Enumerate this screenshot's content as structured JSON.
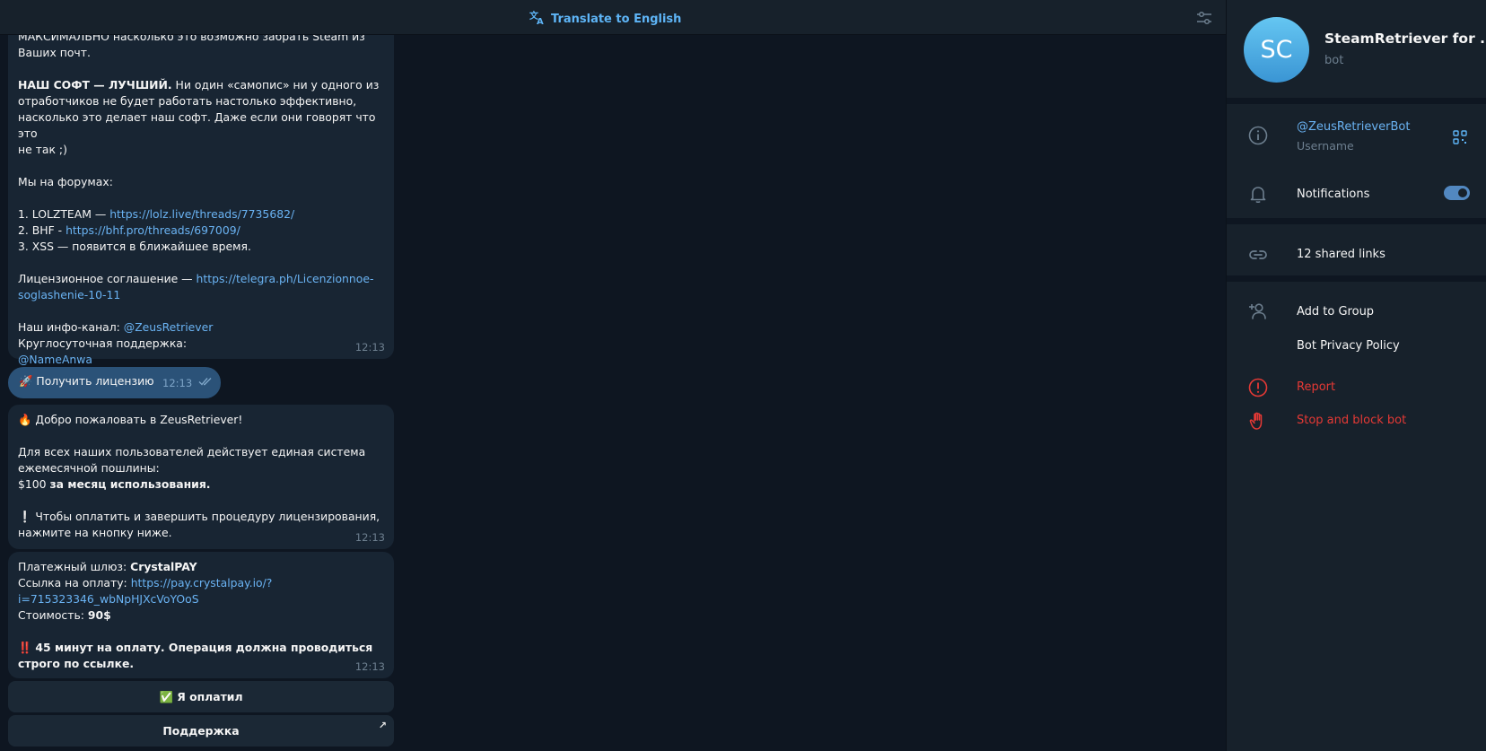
{
  "topbar": {
    "translate_label": "Translate to English"
  },
  "messages": {
    "msg1": {
      "lines": [
        "МАКСИМАЛЬНО насколько это возможно забрать Steam из",
        "Ваших почт."
      ],
      "best_bold": "НАШ СОФТ — ЛУЧШИЙ.",
      "best_rest_1": " Ни один «самопис» ни у одного из",
      "best_rest_2": "отработчиков не будет работать настолько эффективно,",
      "best_rest_3": "насколько это делает наш софт. Даже если они говорят что это",
      "best_rest_4": "не так ;)",
      "forums_title": "Мы на форумах:",
      "forum1_text": "1. LOLZTEAM — ",
      "forum1_link": "https://lolz.live/threads/7735682/",
      "forum2_text": "2. BHF - ",
      "forum2_link": "https://bhf.pro/threads/697009/",
      "forum3_text": "3. XSS — появится в ближайшее время.",
      "license_text": "Лицензионное соглашение — ",
      "license_link_1": "https://telegra.ph/Licenzionnoe-",
      "license_link_2": "soglashenie-10-11",
      "channel_text": "Наш инфо-канал: ",
      "channel_link": "@ZeusRetriever",
      "support_text": "Круглосуточная поддержка:",
      "support_link": "@NameAnwa",
      "time": "12:13"
    },
    "outgoing": {
      "emoji": "🚀",
      "text": "Получить лицензию",
      "time": "12:13"
    },
    "msg2": {
      "emoji": "🔥",
      "welcome": "Добро пожаловать в ZeusRetriever!",
      "line1": "Для всех наших пользователей действует единая система",
      "line2": "ежемесячной пошлины:",
      "price": "$100 ",
      "price_bold": "за месяц использования.",
      "warn_emoji": "❕",
      "line3": "Чтобы оплатить и завершить процедуру лицензирования,",
      "line4": "нажмите на кнопку ниже.",
      "time": "12:13"
    },
    "msg3": {
      "gateway_label": "Платежный шлюз: ",
      "gateway_value": "CrystalPAY",
      "pay_label": "Ссылка на оплату: ",
      "pay_link_1": "https://pay.crystalpay.io/?",
      "pay_link_2": "i=715323346_wbNpHJXcVoYOoS",
      "cost_label": "Стоимость: ",
      "cost_value": "90$",
      "alarm_emoji": "‼️",
      "warn_1": "45 минут на оплату. Операция должна проводиться",
      "warn_2": "строго по ссылке.",
      "time": "12:13"
    }
  },
  "keyboard": {
    "paid_emoji": "✅",
    "paid_label": "Я оплатил",
    "support_label": "Поддержка",
    "support_ext_icon": "↗"
  },
  "panel": {
    "avatar_initials": "SC",
    "avatar_colors": [
      "#65c6f2",
      "#3a95d4"
    ],
    "bot_name": "SteamRetriever for ...",
    "bot_sub": "bot",
    "username_value": "@ZeusRetrieverBot",
    "username_label": "Username",
    "notifications_label": "Notifications",
    "notifications_on": true,
    "shared_links": "12 shared links",
    "add_to_group": "Add to Group",
    "privacy_policy": "Bot Privacy Policy",
    "report": "Report",
    "stop_block": "Stop and block bot",
    "danger_color": "#e53935",
    "accent_color": "#6ab3f3"
  }
}
